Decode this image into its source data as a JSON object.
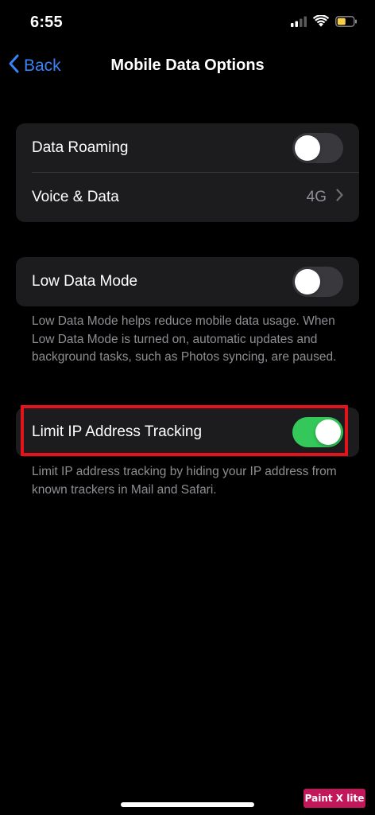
{
  "status_bar": {
    "time": "6:55",
    "signal_icon": "cellular-signal-icon",
    "wifi_icon": "wifi-icon",
    "battery_icon": "battery-icon",
    "battery_color": "#f7ce46"
  },
  "nav": {
    "back_label": "Back",
    "title": "Mobile Data Options",
    "accent_color": "#3a82f7"
  },
  "group1": {
    "data_roaming": {
      "label": "Data Roaming",
      "enabled": false
    },
    "voice_data": {
      "label": "Voice & Data",
      "value": "4G"
    }
  },
  "group2": {
    "low_data_mode": {
      "label": "Low Data Mode",
      "enabled": false
    },
    "footer": "Low Data Mode helps reduce mobile data usage. When Low Data Mode is turned on, automatic updates and background tasks, such as Photos syncing, are paused."
  },
  "group3": {
    "limit_ip": {
      "label": "Limit IP Address Tracking",
      "enabled": true
    },
    "footer": "Limit IP address tracking by hiding your IP address from known trackers in Mail and Safari."
  },
  "colors": {
    "toggle_on": "#34c759",
    "highlight": "#e3121b"
  },
  "watermark": "Paint X lite"
}
